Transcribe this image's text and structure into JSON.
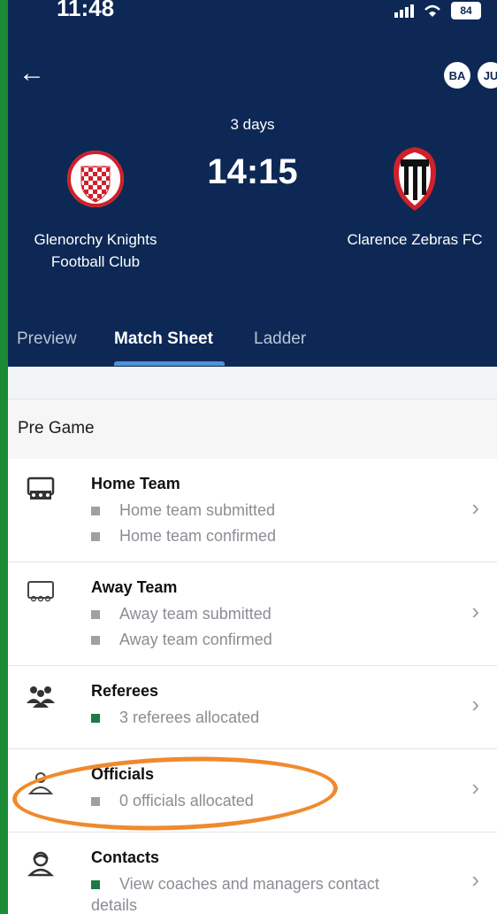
{
  "status": {
    "time": "11:48",
    "battery": "84"
  },
  "header": {
    "avatars": [
      "BA",
      "JU"
    ],
    "countdown": "3 days",
    "kickoff": "14:15",
    "home_team": {
      "name_line1": "Glenorchy Knights",
      "name_line2": "Football Club"
    },
    "away_team": {
      "name": "Clarence Zebras FC"
    }
  },
  "tabs": [
    {
      "label": "Preview",
      "active": false
    },
    {
      "label": "Match Sheet",
      "active": true
    },
    {
      "label": "Ladder",
      "active": false
    }
  ],
  "section": {
    "title": "Pre Game"
  },
  "rows": [
    {
      "title": "Home Team",
      "items": [
        "Home team submitted",
        "Home team confirmed"
      ]
    },
    {
      "title": "Away Team",
      "items": [
        "Away team submitted",
        "Away team confirmed"
      ]
    },
    {
      "title": "Referees",
      "items": [
        "3 referees allocated"
      ]
    },
    {
      "title": "Officials",
      "items": [
        "0 officials allocated"
      ]
    },
    {
      "title": "Contacts",
      "items": [
        "View coaches and managers contact",
        "details"
      ]
    }
  ],
  "colors": {
    "header_bg": "#0d2855",
    "accent": "#4a93dd",
    "annotation": "#f08a2d",
    "status_green": "#1d7a44"
  }
}
